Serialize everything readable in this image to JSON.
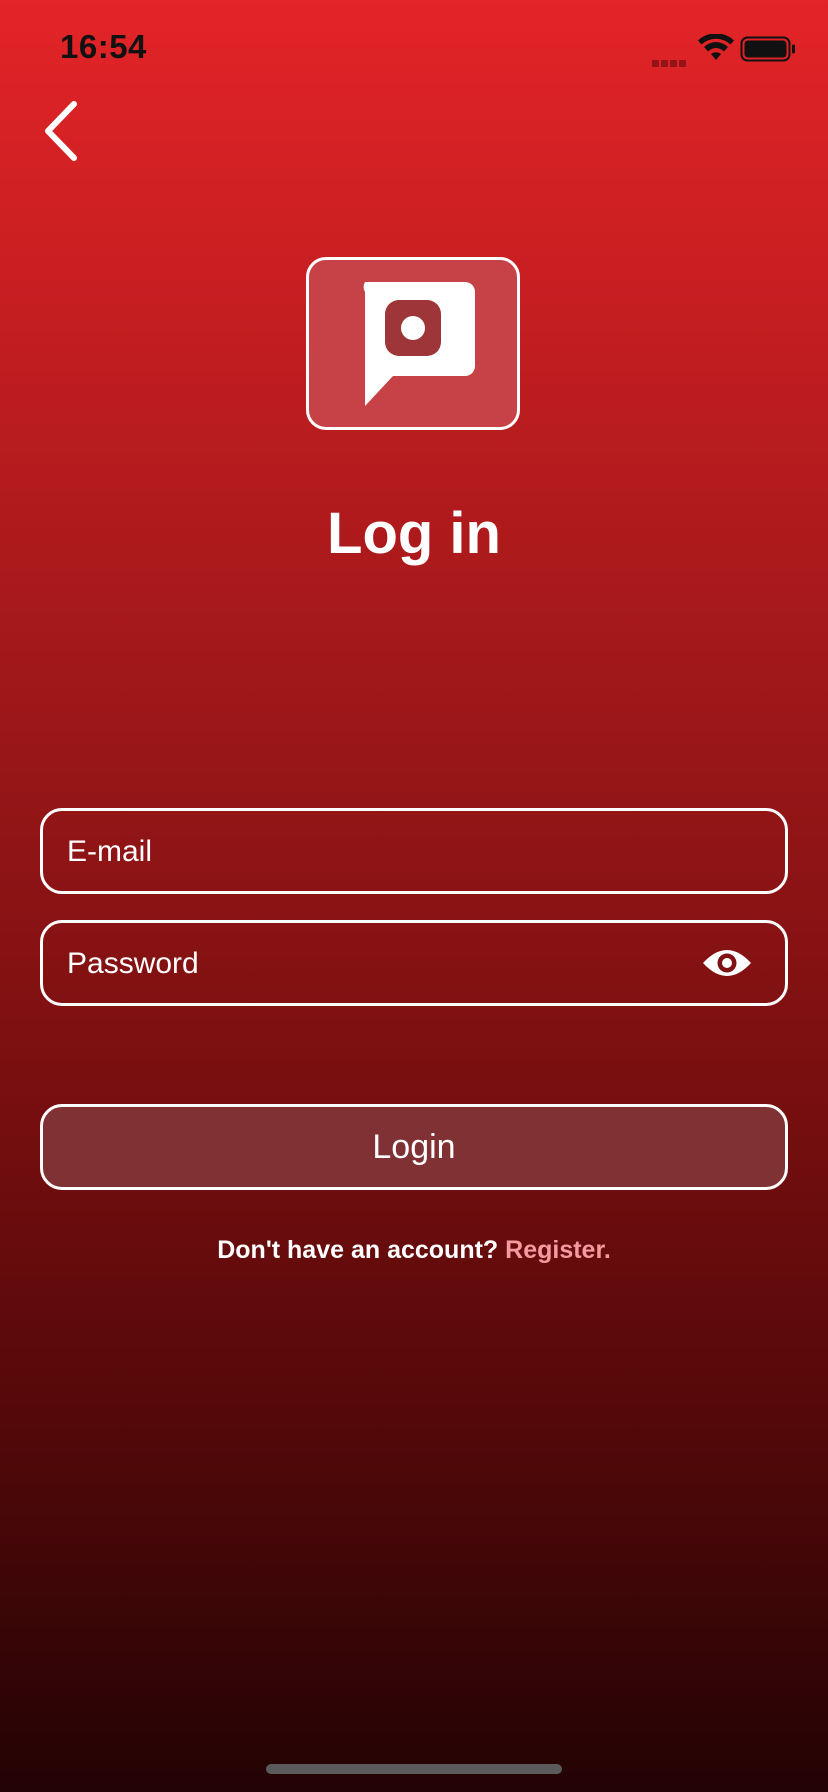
{
  "status_bar": {
    "time": "16:54",
    "icons": [
      "signal-icon",
      "wifi-icon",
      "battery-icon"
    ]
  },
  "header": {
    "back_icon": "chevron-left-icon"
  },
  "logo": {
    "icon": "camera-chat-bubble-icon",
    "background_color": "#c64246"
  },
  "title": "Log in",
  "form": {
    "email": {
      "placeholder": "E-mail",
      "value": ""
    },
    "password": {
      "placeholder": "Password",
      "value": "",
      "toggle_icon": "eye-icon"
    },
    "login_label": "Login"
  },
  "register": {
    "prompt": "Don't have an account?",
    "link_label": "Register."
  },
  "colors": {
    "gradient_top": "#e32428",
    "gradient_bottom": "#230304",
    "link": "#f59ba0",
    "button_fill": "#7f3134"
  }
}
